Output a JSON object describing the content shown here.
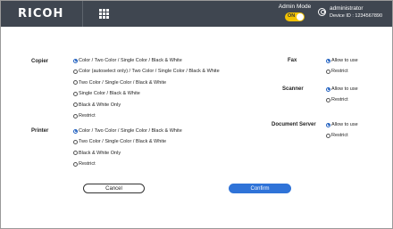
{
  "header": {
    "logo": "RICOH",
    "admin_mode_label": "Admin Mode",
    "admin_toggle": "ON",
    "user_name": "administrator",
    "device_id": "Device ID : 1234567890"
  },
  "sections": {
    "copier": {
      "label": "Copier",
      "options": [
        {
          "label": "Color / Two Color / Single Color / Black & White",
          "selected": true
        },
        {
          "label": "Color (autoselect only) / Two Color / Single Color / Black & White",
          "selected": false
        },
        {
          "label": "Two Color / Single Color / Black & White",
          "selected": false
        },
        {
          "label": "Single Color / Black & White",
          "selected": false
        },
        {
          "label": "Black & White Only",
          "selected": false
        },
        {
          "label": "Restrict",
          "selected": false
        }
      ]
    },
    "printer": {
      "label": "Printer",
      "options": [
        {
          "label": "Color / Two Color / Single Color / Black & White",
          "selected": true
        },
        {
          "label": "Two Color / Single Color / Black & White",
          "selected": false
        },
        {
          "label": "Black & White Only",
          "selected": false
        },
        {
          "label": "Restrict",
          "selected": false
        }
      ]
    },
    "fax": {
      "label": "Fax",
      "options": [
        {
          "label": "Allow to use",
          "selected": true
        },
        {
          "label": "Restrict",
          "selected": false
        }
      ]
    },
    "scanner": {
      "label": "Scanner",
      "options": [
        {
          "label": "Allow to use",
          "selected": true
        },
        {
          "label": "Restrict",
          "selected": false
        }
      ]
    },
    "document_server": {
      "label": "Document Server",
      "options": [
        {
          "label": "Allow to use",
          "selected": true
        },
        {
          "label": "Restrict",
          "selected": false
        }
      ]
    }
  },
  "buttons": {
    "cancel": "Cancel",
    "confirm": "Confirm"
  },
  "colors": {
    "header_bg": "#3f4650",
    "toggle": "#f2c200",
    "confirm_button": "#2f73d8",
    "radio_selected": "#1f5fbf"
  }
}
